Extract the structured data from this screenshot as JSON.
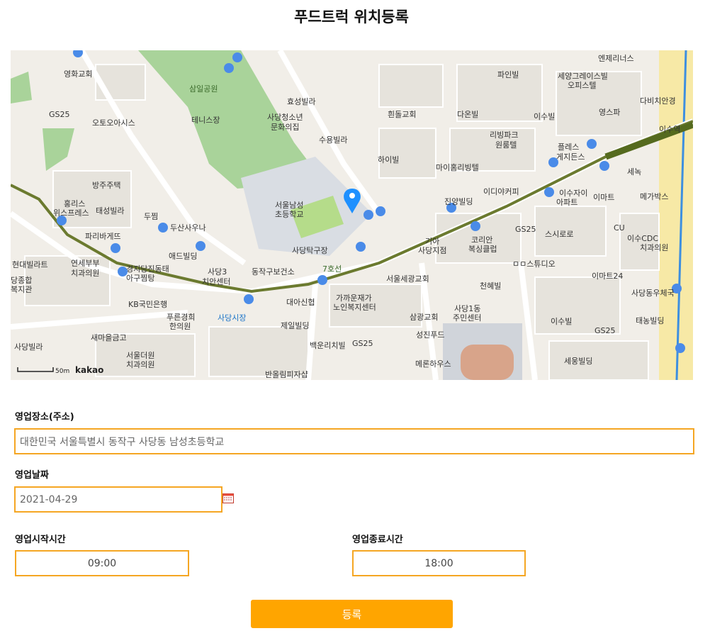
{
  "page": {
    "title": "푸드트럭 위치등록"
  },
  "map": {
    "provider_label": "kakao",
    "scale_label": "50m",
    "places": [
      {
        "name": "영화교회"
      },
      {
        "name": "삼일공원"
      },
      {
        "name": "효성빌라"
      },
      {
        "name": "GS25"
      },
      {
        "name": "오토오아시스"
      },
      {
        "name": "테니스장"
      },
      {
        "name": "사당청소년"
      },
      {
        "name": "문화의집"
      },
      {
        "name": "수용빌라"
      },
      {
        "name": "흰돌교회"
      },
      {
        "name": "다온빌"
      },
      {
        "name": "파인빌"
      },
      {
        "name": "세양그레이스빌"
      },
      {
        "name": "오피스텔"
      },
      {
        "name": "엔제리너스"
      },
      {
        "name": "영스파"
      },
      {
        "name": "다비치안경"
      },
      {
        "name": "이수빌"
      },
      {
        "name": "리빙파크"
      },
      {
        "name": "원룸텔"
      },
      {
        "name": "플레스"
      },
      {
        "name": "게지든스"
      },
      {
        "name": "하이빌"
      },
      {
        "name": "마이홈리빙텔"
      },
      {
        "name": "방주주택"
      },
      {
        "name": "서울남성"
      },
      {
        "name": "초등학교"
      },
      {
        "name": "이디야커피"
      },
      {
        "name": "이수자이"
      },
      {
        "name": "아파트"
      },
      {
        "name": "이마트"
      },
      {
        "name": "세녹"
      },
      {
        "name": "메가박스"
      },
      {
        "name": "홍리스"
      },
      {
        "name": "위스프레스"
      },
      {
        "name": "태성빌라"
      },
      {
        "name": "두찜"
      },
      {
        "name": "두산사우나"
      },
      {
        "name": "파리바게뜨"
      },
      {
        "name": "진양빌딩"
      },
      {
        "name": "GS25"
      },
      {
        "name": "스시로로"
      },
      {
        "name": "CU"
      },
      {
        "name": "이수CDC"
      },
      {
        "name": "치과의원"
      },
      {
        "name": "애드빌딩"
      },
      {
        "name": "사당탁구장"
      },
      {
        "name": "기아"
      },
      {
        "name": "사당지점"
      },
      {
        "name": "코리안"
      },
      {
        "name": "복싱클럽"
      },
      {
        "name": "현대빌라트"
      },
      {
        "name": "연세부부"
      },
      {
        "name": "치과의원"
      },
      {
        "name": "경지당진동태"
      },
      {
        "name": "아구찜탕"
      },
      {
        "name": "사당3"
      },
      {
        "name": "치안센터"
      },
      {
        "name": "동작구보건소"
      },
      {
        "name": "서울세광교회"
      },
      {
        "name": "ㅁㅁ스튜디오"
      },
      {
        "name": "이마트24"
      },
      {
        "name": "천혜빌"
      },
      {
        "name": "사당동우체국"
      },
      {
        "name": "KB국민은행"
      },
      {
        "name": "대아신협"
      },
      {
        "name": "가까운재가"
      },
      {
        "name": "노인복지센터"
      },
      {
        "name": "사당1동"
      },
      {
        "name": "주민센터"
      },
      {
        "name": "푸른경희"
      },
      {
        "name": "한의원"
      },
      {
        "name": "사당시장"
      },
      {
        "name": "삼광교회"
      },
      {
        "name": "이수빌"
      },
      {
        "name": "태농빌딩"
      },
      {
        "name": "새마을금고"
      },
      {
        "name": "제일빌딩"
      },
      {
        "name": "성진푸드"
      },
      {
        "name": "GS25"
      },
      {
        "name": "사당빌라"
      },
      {
        "name": "서울더원"
      },
      {
        "name": "치과의원"
      },
      {
        "name": "백운리치빌"
      },
      {
        "name": "GS25"
      },
      {
        "name": "메론하우스"
      },
      {
        "name": "세웅빌딩"
      },
      {
        "name": "반올림피자샵"
      },
      {
        "name": "당종합"
      },
      {
        "name": "복지관"
      },
      {
        "name": "이수역"
      },
      {
        "name": "7호선"
      }
    ]
  },
  "form": {
    "address_label": "영업장소(주소)",
    "address_value": "대한민국 서울특별시 동작구 사당동 남성초등학교",
    "date_label": "영업날짜",
    "date_value": "2021-04-29",
    "start_label": "영업시작시간",
    "start_value": "09:00",
    "end_label": "영업종료시간",
    "end_value": "18:00",
    "submit_label": "등록"
  },
  "colors": {
    "accent": "#ffa500",
    "input_border": "#f5a623",
    "marker": "#1e90ff"
  }
}
